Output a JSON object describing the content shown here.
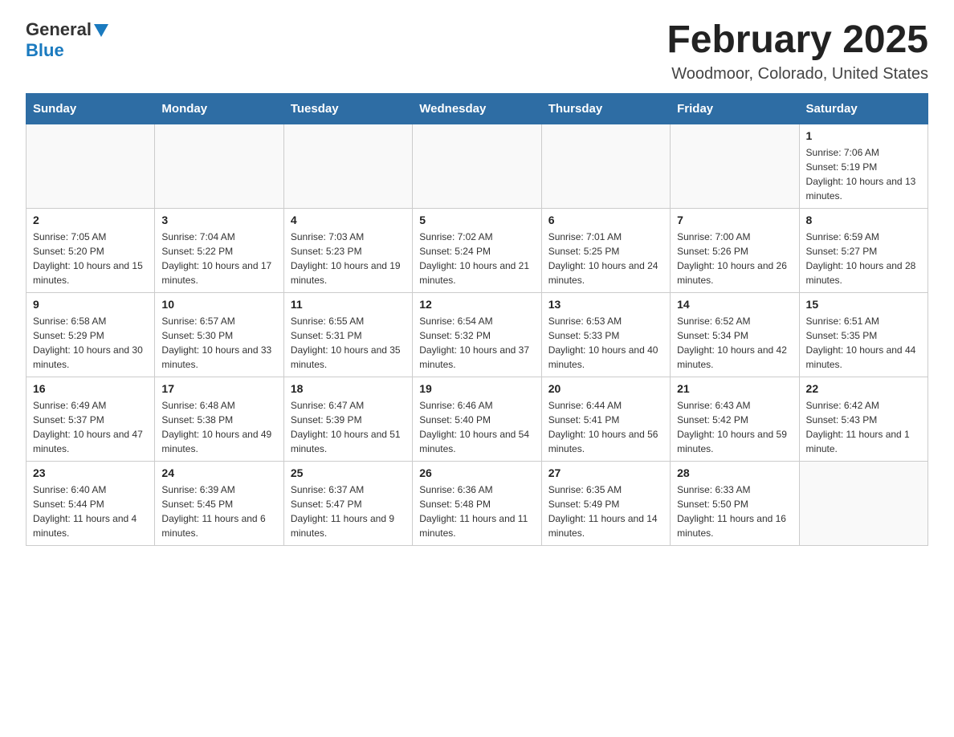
{
  "header": {
    "logo_general": "General",
    "logo_blue": "Blue",
    "title": "February 2025",
    "subtitle": "Woodmoor, Colorado, United States"
  },
  "weekdays": [
    "Sunday",
    "Monday",
    "Tuesday",
    "Wednesday",
    "Thursday",
    "Friday",
    "Saturday"
  ],
  "weeks": [
    [
      {
        "day": "",
        "info": ""
      },
      {
        "day": "",
        "info": ""
      },
      {
        "day": "",
        "info": ""
      },
      {
        "day": "",
        "info": ""
      },
      {
        "day": "",
        "info": ""
      },
      {
        "day": "",
        "info": ""
      },
      {
        "day": "1",
        "info": "Sunrise: 7:06 AM\nSunset: 5:19 PM\nDaylight: 10 hours and 13 minutes."
      }
    ],
    [
      {
        "day": "2",
        "info": "Sunrise: 7:05 AM\nSunset: 5:20 PM\nDaylight: 10 hours and 15 minutes."
      },
      {
        "day": "3",
        "info": "Sunrise: 7:04 AM\nSunset: 5:22 PM\nDaylight: 10 hours and 17 minutes."
      },
      {
        "day": "4",
        "info": "Sunrise: 7:03 AM\nSunset: 5:23 PM\nDaylight: 10 hours and 19 minutes."
      },
      {
        "day": "5",
        "info": "Sunrise: 7:02 AM\nSunset: 5:24 PM\nDaylight: 10 hours and 21 minutes."
      },
      {
        "day": "6",
        "info": "Sunrise: 7:01 AM\nSunset: 5:25 PM\nDaylight: 10 hours and 24 minutes."
      },
      {
        "day": "7",
        "info": "Sunrise: 7:00 AM\nSunset: 5:26 PM\nDaylight: 10 hours and 26 minutes."
      },
      {
        "day": "8",
        "info": "Sunrise: 6:59 AM\nSunset: 5:27 PM\nDaylight: 10 hours and 28 minutes."
      }
    ],
    [
      {
        "day": "9",
        "info": "Sunrise: 6:58 AM\nSunset: 5:29 PM\nDaylight: 10 hours and 30 minutes."
      },
      {
        "day": "10",
        "info": "Sunrise: 6:57 AM\nSunset: 5:30 PM\nDaylight: 10 hours and 33 minutes."
      },
      {
        "day": "11",
        "info": "Sunrise: 6:55 AM\nSunset: 5:31 PM\nDaylight: 10 hours and 35 minutes."
      },
      {
        "day": "12",
        "info": "Sunrise: 6:54 AM\nSunset: 5:32 PM\nDaylight: 10 hours and 37 minutes."
      },
      {
        "day": "13",
        "info": "Sunrise: 6:53 AM\nSunset: 5:33 PM\nDaylight: 10 hours and 40 minutes."
      },
      {
        "day": "14",
        "info": "Sunrise: 6:52 AM\nSunset: 5:34 PM\nDaylight: 10 hours and 42 minutes."
      },
      {
        "day": "15",
        "info": "Sunrise: 6:51 AM\nSunset: 5:35 PM\nDaylight: 10 hours and 44 minutes."
      }
    ],
    [
      {
        "day": "16",
        "info": "Sunrise: 6:49 AM\nSunset: 5:37 PM\nDaylight: 10 hours and 47 minutes."
      },
      {
        "day": "17",
        "info": "Sunrise: 6:48 AM\nSunset: 5:38 PM\nDaylight: 10 hours and 49 minutes."
      },
      {
        "day": "18",
        "info": "Sunrise: 6:47 AM\nSunset: 5:39 PM\nDaylight: 10 hours and 51 minutes."
      },
      {
        "day": "19",
        "info": "Sunrise: 6:46 AM\nSunset: 5:40 PM\nDaylight: 10 hours and 54 minutes."
      },
      {
        "day": "20",
        "info": "Sunrise: 6:44 AM\nSunset: 5:41 PM\nDaylight: 10 hours and 56 minutes."
      },
      {
        "day": "21",
        "info": "Sunrise: 6:43 AM\nSunset: 5:42 PM\nDaylight: 10 hours and 59 minutes."
      },
      {
        "day": "22",
        "info": "Sunrise: 6:42 AM\nSunset: 5:43 PM\nDaylight: 11 hours and 1 minute."
      }
    ],
    [
      {
        "day": "23",
        "info": "Sunrise: 6:40 AM\nSunset: 5:44 PM\nDaylight: 11 hours and 4 minutes."
      },
      {
        "day": "24",
        "info": "Sunrise: 6:39 AM\nSunset: 5:45 PM\nDaylight: 11 hours and 6 minutes."
      },
      {
        "day": "25",
        "info": "Sunrise: 6:37 AM\nSunset: 5:47 PM\nDaylight: 11 hours and 9 minutes."
      },
      {
        "day": "26",
        "info": "Sunrise: 6:36 AM\nSunset: 5:48 PM\nDaylight: 11 hours and 11 minutes."
      },
      {
        "day": "27",
        "info": "Sunrise: 6:35 AM\nSunset: 5:49 PM\nDaylight: 11 hours and 14 minutes."
      },
      {
        "day": "28",
        "info": "Sunrise: 6:33 AM\nSunset: 5:50 PM\nDaylight: 11 hours and 16 minutes."
      },
      {
        "day": "",
        "info": ""
      }
    ]
  ]
}
